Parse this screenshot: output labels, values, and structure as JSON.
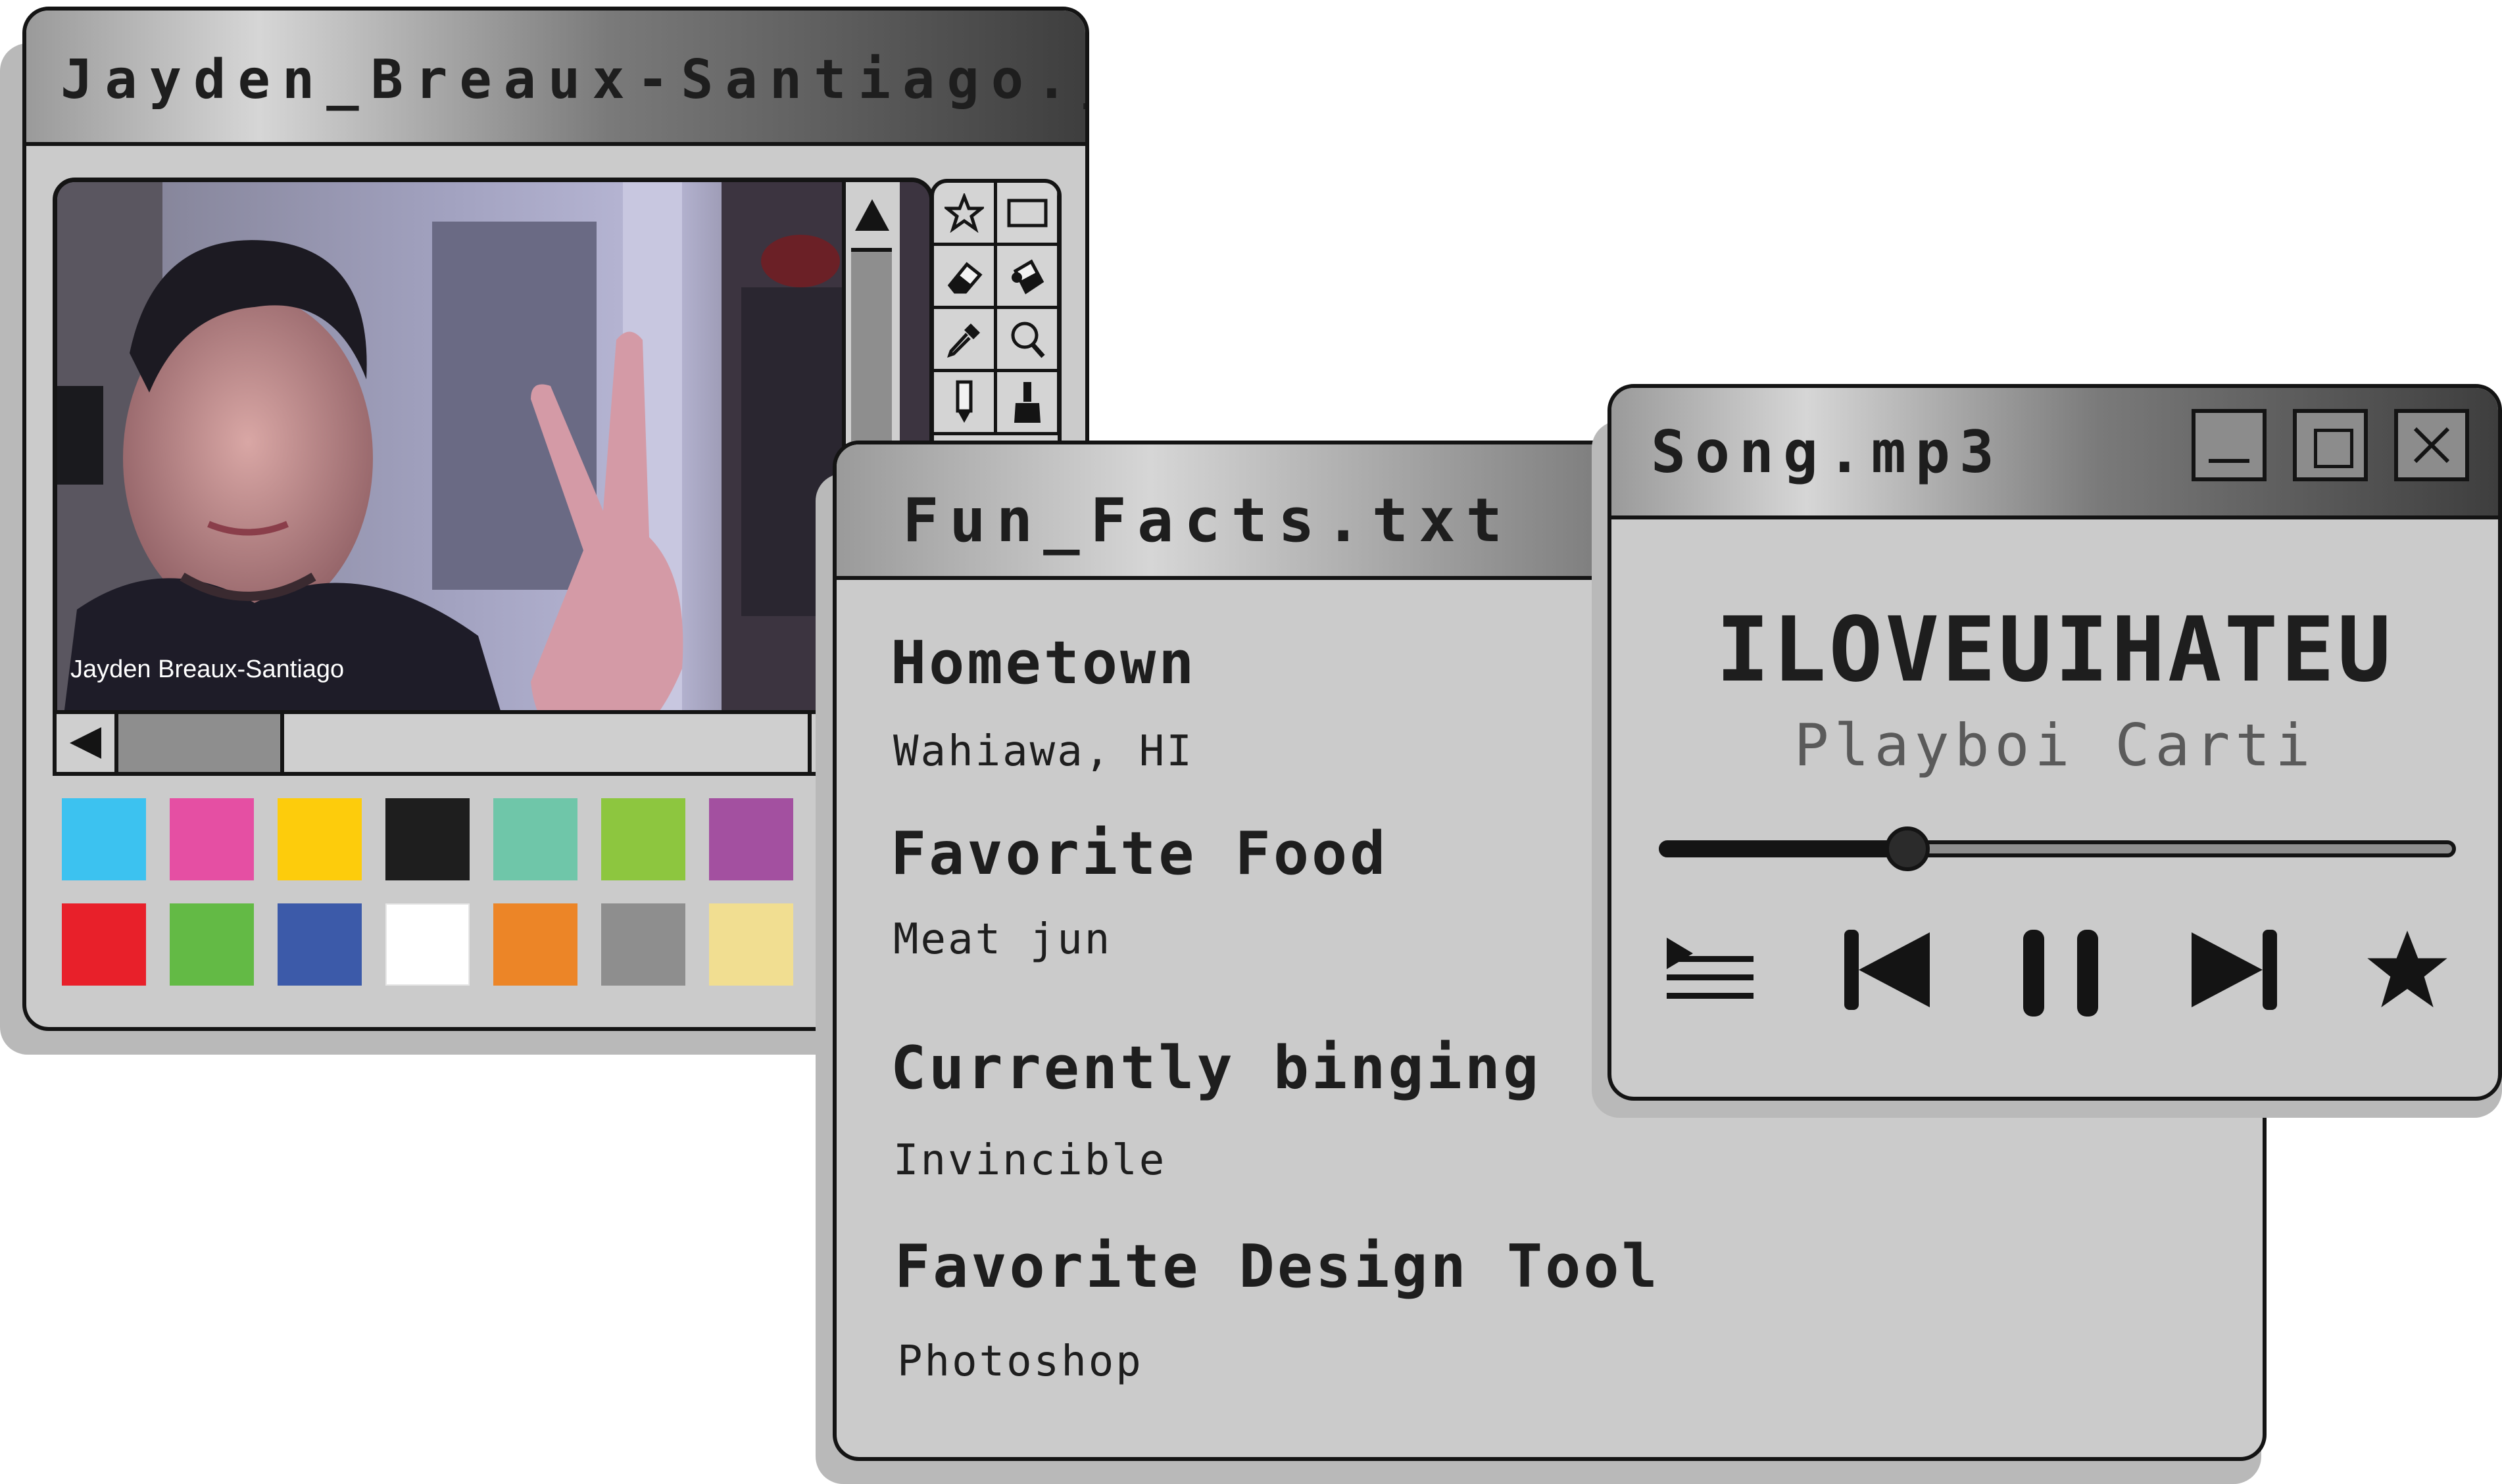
{
  "image_window": {
    "title": "Jayden_Breaux-Santiago.jpeg",
    "caption": "Jayden Breaux-Santiago",
    "swatches_row1": [
      "#3cc2f0",
      "#e54fa3",
      "#fdcc0c",
      "#1e1e1e",
      "#6fc6a9",
      "#8dc63f",
      "#a350a0",
      "#2a2a2a"
    ],
    "swatches_row2": [
      "#e8202a",
      "#63ba45",
      "#3c5aa9",
      "#ffffff",
      "#ec8527",
      "#8e8e8e",
      "#f1de91",
      "#9d8c7c"
    ],
    "tools": [
      "star-tool",
      "rectangle-tool",
      "eraser-tool",
      "paint-bucket-tool",
      "eyedropper-tool",
      "zoom-tool",
      "pencil-tool",
      "brush-tool"
    ]
  },
  "facts_window": {
    "title": "Fun_Facts.txt",
    "facts": [
      {
        "label": "Hometown",
        "value": "Wahiawa, HI"
      },
      {
        "label": "Favorite Food",
        "value": "Meat jun"
      },
      {
        "label": "Currently binging",
        "value": "Invincible"
      },
      {
        "label": "Favorite Design Tool",
        "value": "Photoshop"
      }
    ]
  },
  "player_window": {
    "title": "Song.mp3",
    "song_title": "ILOVEUIHATEU",
    "artist": "Playboi Carti",
    "progress": 0.31,
    "controls": [
      "playlist-icon",
      "previous-icon",
      "pause-icon",
      "next-icon",
      "favorite-star-icon"
    ]
  }
}
